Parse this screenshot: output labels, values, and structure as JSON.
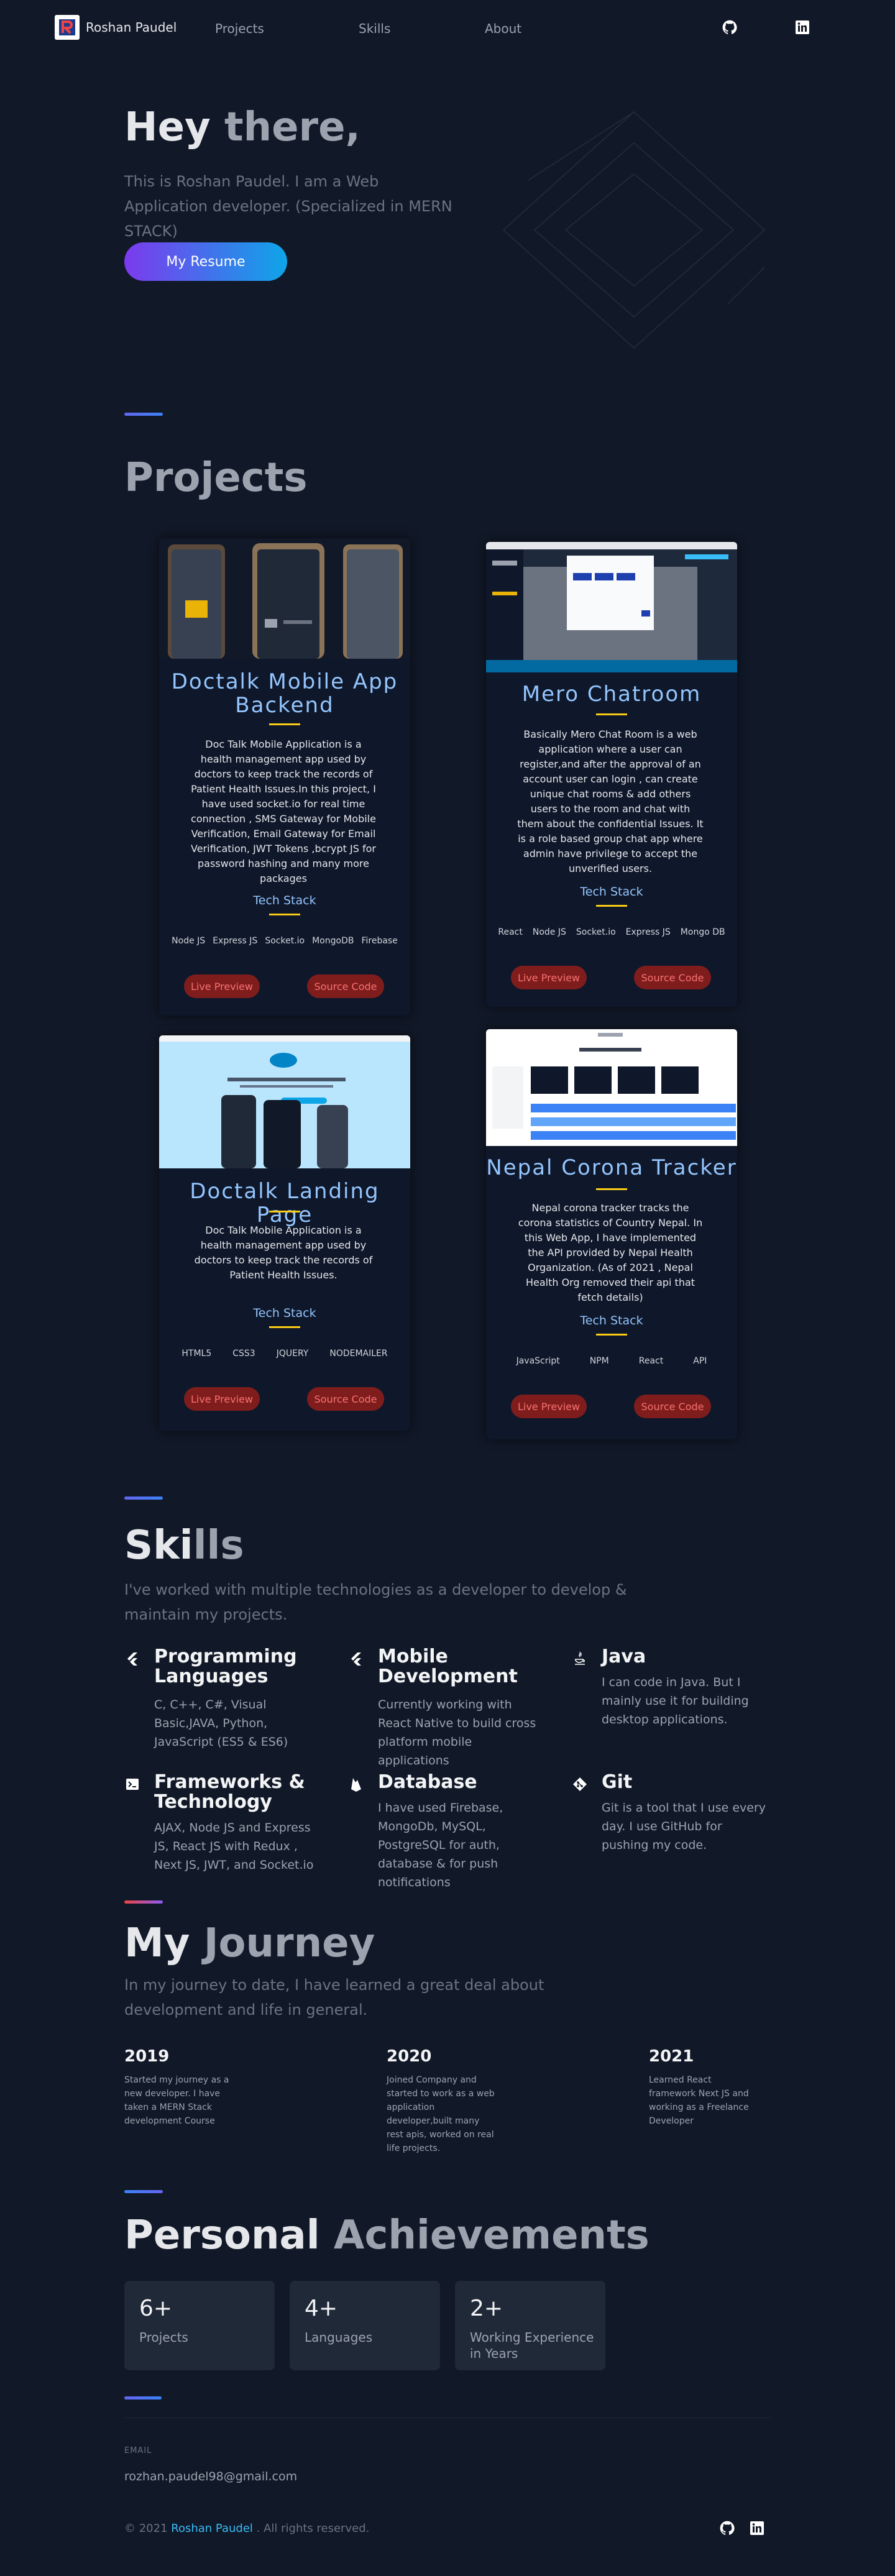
{
  "nav": {
    "brand": "Roshan Paudel",
    "links": [
      "Projects",
      "Skills",
      "About"
    ],
    "icons": [
      "github-icon",
      "linkedin-icon"
    ]
  },
  "hero": {
    "greeting": "Hey",
    "greeting_soft": "there,",
    "description": "This is Roshan Paudel. I am a Web Application developer. (Specialized in MERN STACK)",
    "resume_button": "My Resume"
  },
  "projects": {
    "title": "Projects",
    "tech_stack_label": "Tech Stack",
    "live_label": "Live Preview",
    "source_label": "Source Code",
    "items": [
      {
        "title": "Doctalk Mobile App Backend",
        "description": "Doc Talk Mobile Application is a health management app used by doctors to keep track the records of Patient Health Issues.In this project, I have used socket.io for real time connection , SMS Gateway for Mobile Verification, Email Gateway for Email Verification, JWT Tokens ,bcrypt JS for password hashing and many more packages",
        "stack": [
          "Node JS",
          "Express JS",
          "Socket.io",
          "MongoDB",
          "Firebase"
        ]
      },
      {
        "title": "Mero Chatroom",
        "description": "Basically Mero Chat Room is a web application where a user can register,and after the approval of an account user can login , can create unique chat rooms & add others users to the room and chat with them about the confidential Issues. It is a role based group chat app where admin have privilege to accept the unverified users.",
        "stack": [
          "React",
          "Node JS",
          "Socket.io",
          "Express JS",
          "Mongo DB"
        ]
      },
      {
        "title": "Doctalk Landing Page",
        "description": "Doc Talk Mobile Application is a health management app used by doctors to keep track the records of Patient Health Issues.",
        "stack": [
          "HTML5",
          "CSS3",
          "JQUERY",
          "NODEMAILER"
        ]
      },
      {
        "title": "Nepal Corona Tracker",
        "description": "Nepal corona tracker tracks the corona statistics of Country Nepal. In this Web App, I have implemented the API provided by Nepal Health Organization. (As of 2021 , Nepal Health Org removed their api that fetch details)",
        "stack": [
          "JavaScript",
          "NPM",
          "React",
          "API"
        ]
      }
    ]
  },
  "skills": {
    "title_a": "Ski",
    "title_b": "lls",
    "subtitle": "I've worked with multiple technologies as a developer to develop & maintain my projects.",
    "items": [
      {
        "title": "Programming Languages",
        "desc": "C, C++, C#, Visual Basic,JAVA, Python, JavaScript (ES5 & ES6)",
        "icon": "flutter-icon"
      },
      {
        "title": "Mobile Development",
        "desc": "Currently working with React Native to build cross platform mobile applications",
        "icon": "flutter-icon"
      },
      {
        "title": "Java",
        "desc": "I can code in Java. But I mainly use it for building desktop applications.",
        "icon": "java-icon"
      },
      {
        "title": "Frameworks & Technology",
        "desc": "AJAX, Node JS and Express JS, React JS with Redux , Next JS, JWT, and Socket.io",
        "icon": "terminal-icon"
      },
      {
        "title": "Database",
        "desc": "I have used Firebase, MongoDb, MySQL, PostgreSQL for auth, database & for push notifications",
        "icon": "firebase-icon"
      },
      {
        "title": "Git",
        "desc": "Git is a tool that I use every day. I use GitHub for pushing my code.",
        "icon": "git-icon"
      }
    ]
  },
  "journey": {
    "title_a": "My",
    "title_b": "Journey",
    "subtitle": "In my journey to date, I have learned a great deal about development and life in general.",
    "items": [
      {
        "year": "2019",
        "text": "Started my journey as a new developer. I have taken a MERN Stack development Course"
      },
      {
        "year": "2020",
        "text": "Joined Company and started to work as a web application developer,built many rest apis, worked on real life projects."
      },
      {
        "year": "2021",
        "text": "Learned React framework Next JS and working as a Freelance Developer"
      }
    ]
  },
  "achievements": {
    "title_a": "Personal",
    "title_b": "Achievements",
    "items": [
      {
        "number": "6+",
        "label": "Projects"
      },
      {
        "number": "4+",
        "label": "Languages"
      },
      {
        "number": "2+",
        "label": "Working Experience in Years"
      }
    ]
  },
  "footer": {
    "email_label": "EMAIL",
    "email": "rozhan.paudel98@gmail.com",
    "copy_prefix": "© 2021",
    "copy_name": "Roshan Paudel",
    "copy_suffix": ". All rights reserved."
  },
  "colors": {
    "background": "#111827",
    "accent_blue": "#93c5fd",
    "accent_yellow": "#facc15",
    "button_red": "#7f1d1d"
  }
}
